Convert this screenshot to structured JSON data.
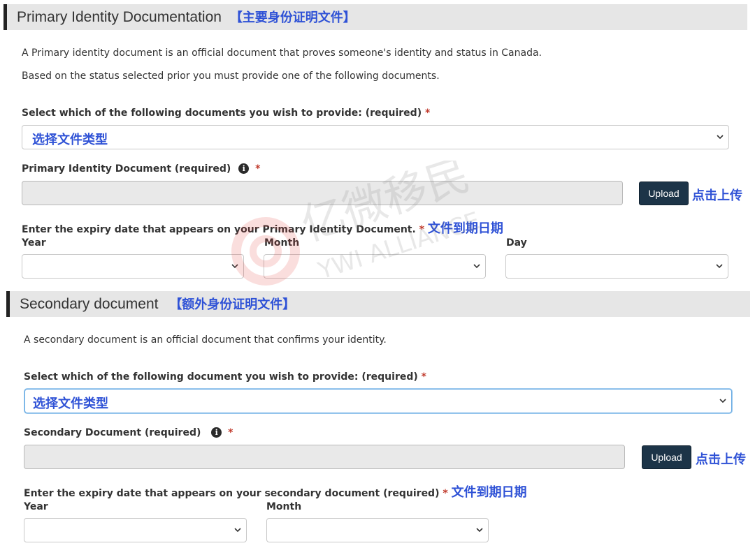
{
  "primary": {
    "title": "Primary Identity Documentation",
    "title_cn": "【主要身份证明文件】",
    "desc1": "A Primary identity document is an official document that proves someone's identity and status in Canada.",
    "desc2": "Based on the status selected prior you must provide one of the following documents.",
    "select_label": "Select which of the following documents you wish to provide: (required)",
    "select_value": "选择文件类型",
    "doc_label": "Primary Identity Document (required)",
    "upload_label": "Upload",
    "upload_note": "点击上传",
    "expiry_label": "Enter the expiry date that appears on your Primary Identity Document.",
    "expiry_note": "文件到期日期",
    "year_label": "Year",
    "month_label": "Month",
    "day_label": "Day"
  },
  "secondary": {
    "title": "Secondary document",
    "title_cn": "【额外身份证明文件】",
    "desc": "A secondary document is an official document that confirms your identity.",
    "select_label": "Select which of the following document you wish to provide: (required)",
    "select_value": "选择文件类型",
    "doc_label": "Secondary Document (required)",
    "upload_label": "Upload",
    "upload_note": "点击上传",
    "expiry_label": "Enter the expiry date that appears on your secondary document (required)",
    "expiry_note": "文件到期日期",
    "year_label": "Year",
    "month_label": "Month"
  },
  "common": {
    "required_mark": "*",
    "info_glyph": "i"
  },
  "watermark": {
    "text_cn": "亿微移民",
    "text_en": "YWI ALLIANCE"
  },
  "colors": {
    "accent_cn": "#2f52d6",
    "required": "#c0392b",
    "upload_bg": "#1c3448",
    "section_bar": "#e6e6e6"
  }
}
